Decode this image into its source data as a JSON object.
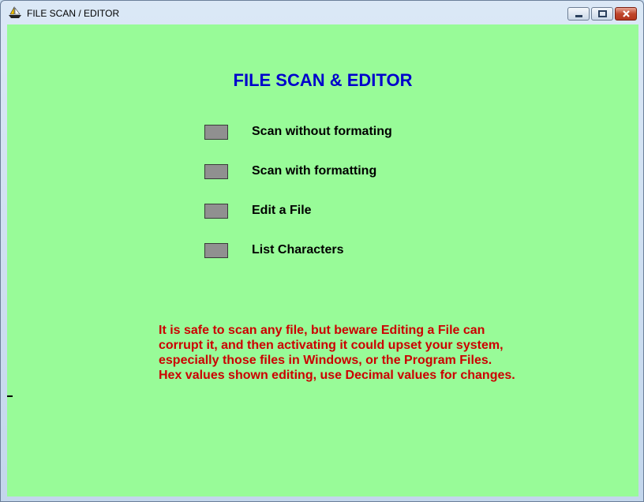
{
  "window": {
    "title": "FILE SCAN / EDITOR",
    "icon": "sailboat-app-icon"
  },
  "main": {
    "heading": "FILE SCAN & EDITOR",
    "options": [
      {
        "label": "Scan without formating"
      },
      {
        "label": "Scan with formatting"
      },
      {
        "label": "Edit a File"
      },
      {
        "label": "List Characters"
      }
    ],
    "warning_lines": [
      "It is safe to scan any file, but beware Editing a File can",
      "corrupt it, and then activating it could upset your system,",
      "especially those files in Windows, or the Program Files.",
      "Hex values shown editing, use Decimal values for changes."
    ]
  },
  "colors": {
    "background": "#98fb98",
    "heading": "#0000cc",
    "warning": "#cc0000",
    "option_button": "#909090"
  }
}
